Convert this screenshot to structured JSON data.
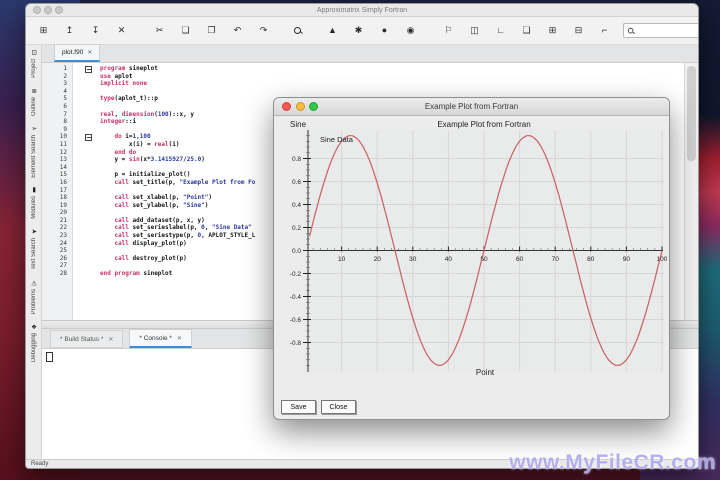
{
  "watermark": "www.MyFileCR.com",
  "colors": {
    "accent_blue": "#3b8fd4",
    "keyword": "#c5306a",
    "literal": "#2b3a9e",
    "curve": "#c75f63",
    "traffic": [
      "#fc5753",
      "#fdbc40",
      "#33c748"
    ]
  },
  "app_window": {
    "title": "Approximatrix Simply Fortran",
    "status": "Ready",
    "search": {
      "placeholder": ""
    }
  },
  "toolbar": {
    "groups": [
      [
        {
          "name": "new-file",
          "glyph": "⊞"
        },
        {
          "name": "open-file",
          "glyph": "↥"
        },
        {
          "name": "save-file",
          "glyph": "↧"
        },
        {
          "name": "close-file",
          "glyph": "✕"
        }
      ],
      [
        {
          "name": "cut",
          "glyph": "✂"
        },
        {
          "name": "copy",
          "glyph": "❏"
        },
        {
          "name": "paste",
          "glyph": "❐"
        },
        {
          "name": "undo",
          "glyph": "↶"
        },
        {
          "name": "redo",
          "glyph": "↷"
        }
      ],
      [
        {
          "name": "find",
          "glyph": ""
        }
      ],
      [
        {
          "name": "clean",
          "glyph": "▲"
        },
        {
          "name": "options",
          "glyph": "✱"
        },
        {
          "name": "build",
          "glyph": "●"
        },
        {
          "name": "build-and-run",
          "glyph": "◉"
        }
      ],
      [
        {
          "name": "launch-debugger",
          "glyph": "⚐"
        },
        {
          "name": "breakpoints",
          "glyph": "◫"
        },
        {
          "name": "step-over",
          "glyph": "∟"
        },
        {
          "name": "step-into",
          "glyph": "❏"
        },
        {
          "name": "step-out",
          "glyph": "⊞"
        },
        {
          "name": "watch",
          "glyph": "⊟"
        },
        {
          "name": "stack",
          "glyph": "⌐"
        }
      ]
    ]
  },
  "sidebar": {
    "items": [
      {
        "label": "Project",
        "icon": "project-icon",
        "glyph": "⊡"
      },
      {
        "label": "Outline",
        "icon": "outline-icon",
        "glyph": "≣"
      },
      {
        "label": "Element Search",
        "icon": "element-search-icon",
        "glyph": "➢"
      },
      {
        "label": "Modules",
        "icon": "modules-icon",
        "glyph": "▮"
      },
      {
        "label": "Text Search",
        "icon": "text-search-icon",
        "glyph": "➤"
      },
      {
        "label": "Problems",
        "icon": "problems-icon",
        "glyph": "⚠"
      },
      {
        "label": "Debugging",
        "icon": "debugging-icon",
        "glyph": "❖"
      }
    ]
  },
  "editor": {
    "tab": {
      "label": "plot.f90",
      "close": "✕"
    },
    "lines": [
      {
        "n": 1,
        "fold": true,
        "seg": [
          [
            "k",
            "program "
          ],
          [
            "p",
            "sineplot"
          ]
        ]
      },
      {
        "n": 2,
        "seg": [
          [
            "k",
            "use "
          ],
          [
            "p",
            "aplot"
          ]
        ]
      },
      {
        "n": 3,
        "seg": [
          [
            "k",
            "implicit none"
          ]
        ]
      },
      {
        "n": 4,
        "seg": []
      },
      {
        "n": 5,
        "seg": [
          [
            "k",
            "type"
          ],
          [
            "p",
            "(aplot_t)::p"
          ]
        ]
      },
      {
        "n": 6,
        "seg": []
      },
      {
        "n": 7,
        "seg": [
          [
            "k",
            "real"
          ],
          [
            "p",
            ", "
          ],
          [
            "k",
            "dimension"
          ],
          [
            "p",
            "("
          ],
          [
            "s",
            "100"
          ],
          [
            "p",
            ")::x, y"
          ]
        ]
      },
      {
        "n": 8,
        "seg": [
          [
            "k",
            "integer"
          ],
          [
            "p",
            "::i"
          ]
        ]
      },
      {
        "n": 9,
        "seg": []
      },
      {
        "n": 10,
        "fold": true,
        "seg": [
          [
            "p",
            "    "
          ],
          [
            "k",
            "do "
          ],
          [
            "p",
            "i="
          ],
          [
            "s",
            "1,100"
          ]
        ]
      },
      {
        "n": 11,
        "seg": [
          [
            "p",
            "        x(i) = "
          ],
          [
            "k",
            "real"
          ],
          [
            "p",
            "(i)"
          ]
        ]
      },
      {
        "n": 12,
        "seg": [
          [
            "p",
            "    "
          ],
          [
            "k",
            "end do"
          ]
        ]
      },
      {
        "n": 13,
        "seg": [
          [
            "p",
            "    y = "
          ],
          [
            "k",
            "sin"
          ],
          [
            "p",
            "(x*"
          ],
          [
            "s",
            "3.1415927"
          ],
          [
            "p",
            "/"
          ],
          [
            "s",
            "25.0"
          ],
          [
            "p",
            ")"
          ]
        ]
      },
      {
        "n": 14,
        "seg": []
      },
      {
        "n": 15,
        "seg": [
          [
            "p",
            "    p = initialize_plot()"
          ]
        ]
      },
      {
        "n": 16,
        "seg": [
          [
            "p",
            "    "
          ],
          [
            "k",
            "call "
          ],
          [
            "p",
            "set_title(p, "
          ],
          [
            "s",
            "\"Example Plot from Fo"
          ]
        ]
      },
      {
        "n": 17,
        "seg": []
      },
      {
        "n": 18,
        "seg": [
          [
            "p",
            "    "
          ],
          [
            "k",
            "call "
          ],
          [
            "p",
            "set_xlabel(p, "
          ],
          [
            "s",
            "\"Point\""
          ],
          [
            "p",
            ")"
          ]
        ]
      },
      {
        "n": 19,
        "seg": [
          [
            "p",
            "    "
          ],
          [
            "k",
            "call "
          ],
          [
            "p",
            "set_ylabel(p, "
          ],
          [
            "s",
            "\"Sine\""
          ],
          [
            "p",
            ")"
          ]
        ]
      },
      {
        "n": 20,
        "seg": []
      },
      {
        "n": 21,
        "seg": [
          [
            "p",
            "    "
          ],
          [
            "k",
            "call "
          ],
          [
            "p",
            "add_dataset(p, x, y)"
          ]
        ]
      },
      {
        "n": 22,
        "seg": [
          [
            "p",
            "    "
          ],
          [
            "k",
            "call "
          ],
          [
            "p",
            "set_serieslabel(p, "
          ],
          [
            "s",
            "0"
          ],
          [
            "p",
            ", "
          ],
          [
            "s",
            "\"Sine Data\""
          ]
        ]
      },
      {
        "n": 23,
        "seg": [
          [
            "p",
            "    "
          ],
          [
            "k",
            "call "
          ],
          [
            "p",
            "set_seriestype(p, "
          ],
          [
            "s",
            "0"
          ],
          [
            "p",
            ", APLOT_STYLE_L"
          ]
        ]
      },
      {
        "n": 24,
        "seg": [
          [
            "p",
            "    "
          ],
          [
            "k",
            "call "
          ],
          [
            "p",
            "display_plot(p)"
          ]
        ]
      },
      {
        "n": 25,
        "seg": []
      },
      {
        "n": 26,
        "seg": [
          [
            "p",
            "    "
          ],
          [
            "k",
            "call "
          ],
          [
            "p",
            "destroy_plot(p)"
          ]
        ]
      },
      {
        "n": 27,
        "seg": []
      },
      {
        "n": 28,
        "seg": [
          [
            "k",
            "end program "
          ],
          [
            "p",
            "sineplot"
          ]
        ]
      }
    ]
  },
  "console_panel": {
    "tabs": [
      {
        "label": "* Build Status *",
        "close": "✕",
        "active": false
      },
      {
        "label": "* Console *",
        "close": "✕",
        "active": true
      }
    ]
  },
  "plot_window": {
    "title": "Example Plot from Fortran",
    "buttons": {
      "save": "Save",
      "close": "Close"
    }
  },
  "chart_data": {
    "type": "line",
    "title": "Example Plot from Fortran",
    "xlabel": "Point",
    "ylabel": "Sine",
    "legend": [
      "Sine Data"
    ],
    "legend_position": "top-left-inside",
    "series_color": "#c75f63",
    "xlim": [
      0,
      100
    ],
    "ylim": [
      -1,
      1
    ],
    "x_ticks": [
      10,
      20,
      30,
      40,
      50,
      60,
      70,
      80,
      90,
      100
    ],
    "y_ticks": [
      0.8,
      0.6,
      0.4,
      0.2,
      0.0,
      -0.2,
      -0.4,
      -0.6,
      -0.8
    ],
    "grid": true,
    "x_start": 1,
    "x_step": 1,
    "values": [
      0.125,
      0.249,
      0.368,
      0.482,
      0.588,
      0.685,
      0.771,
      0.844,
      0.905,
      0.951,
      0.982,
      0.998,
      0.998,
      0.982,
      0.951,
      0.905,
      0.844,
      0.771,
      0.685,
      0.588,
      0.482,
      0.368,
      0.249,
      0.125,
      0,
      -0.125,
      -0.249,
      -0.368,
      -0.482,
      -0.588,
      -0.685,
      -0.771,
      -0.844,
      -0.905,
      -0.951,
      -0.982,
      -0.998,
      -0.998,
      -0.982,
      -0.951,
      -0.905,
      -0.844,
      -0.771,
      -0.685,
      -0.588,
      -0.482,
      -0.368,
      -0.249,
      -0.125,
      0,
      0.125,
      0.249,
      0.368,
      0.482,
      0.588,
      0.685,
      0.771,
      0.844,
      0.905,
      0.951,
      0.982,
      0.998,
      0.998,
      0.982,
      0.951,
      0.905,
      0.844,
      0.771,
      0.685,
      0.588,
      0.482,
      0.368,
      0.249,
      0.125,
      0,
      -0.125,
      -0.249,
      -0.368,
      -0.482,
      -0.588,
      -0.685,
      -0.771,
      -0.844,
      -0.905,
      -0.951,
      -0.982,
      -0.998,
      -0.998,
      -0.982,
      -0.951,
      -0.905,
      -0.844,
      -0.771,
      -0.685,
      -0.588,
      -0.482,
      -0.368,
      -0.249,
      -0.125,
      0
    ]
  }
}
